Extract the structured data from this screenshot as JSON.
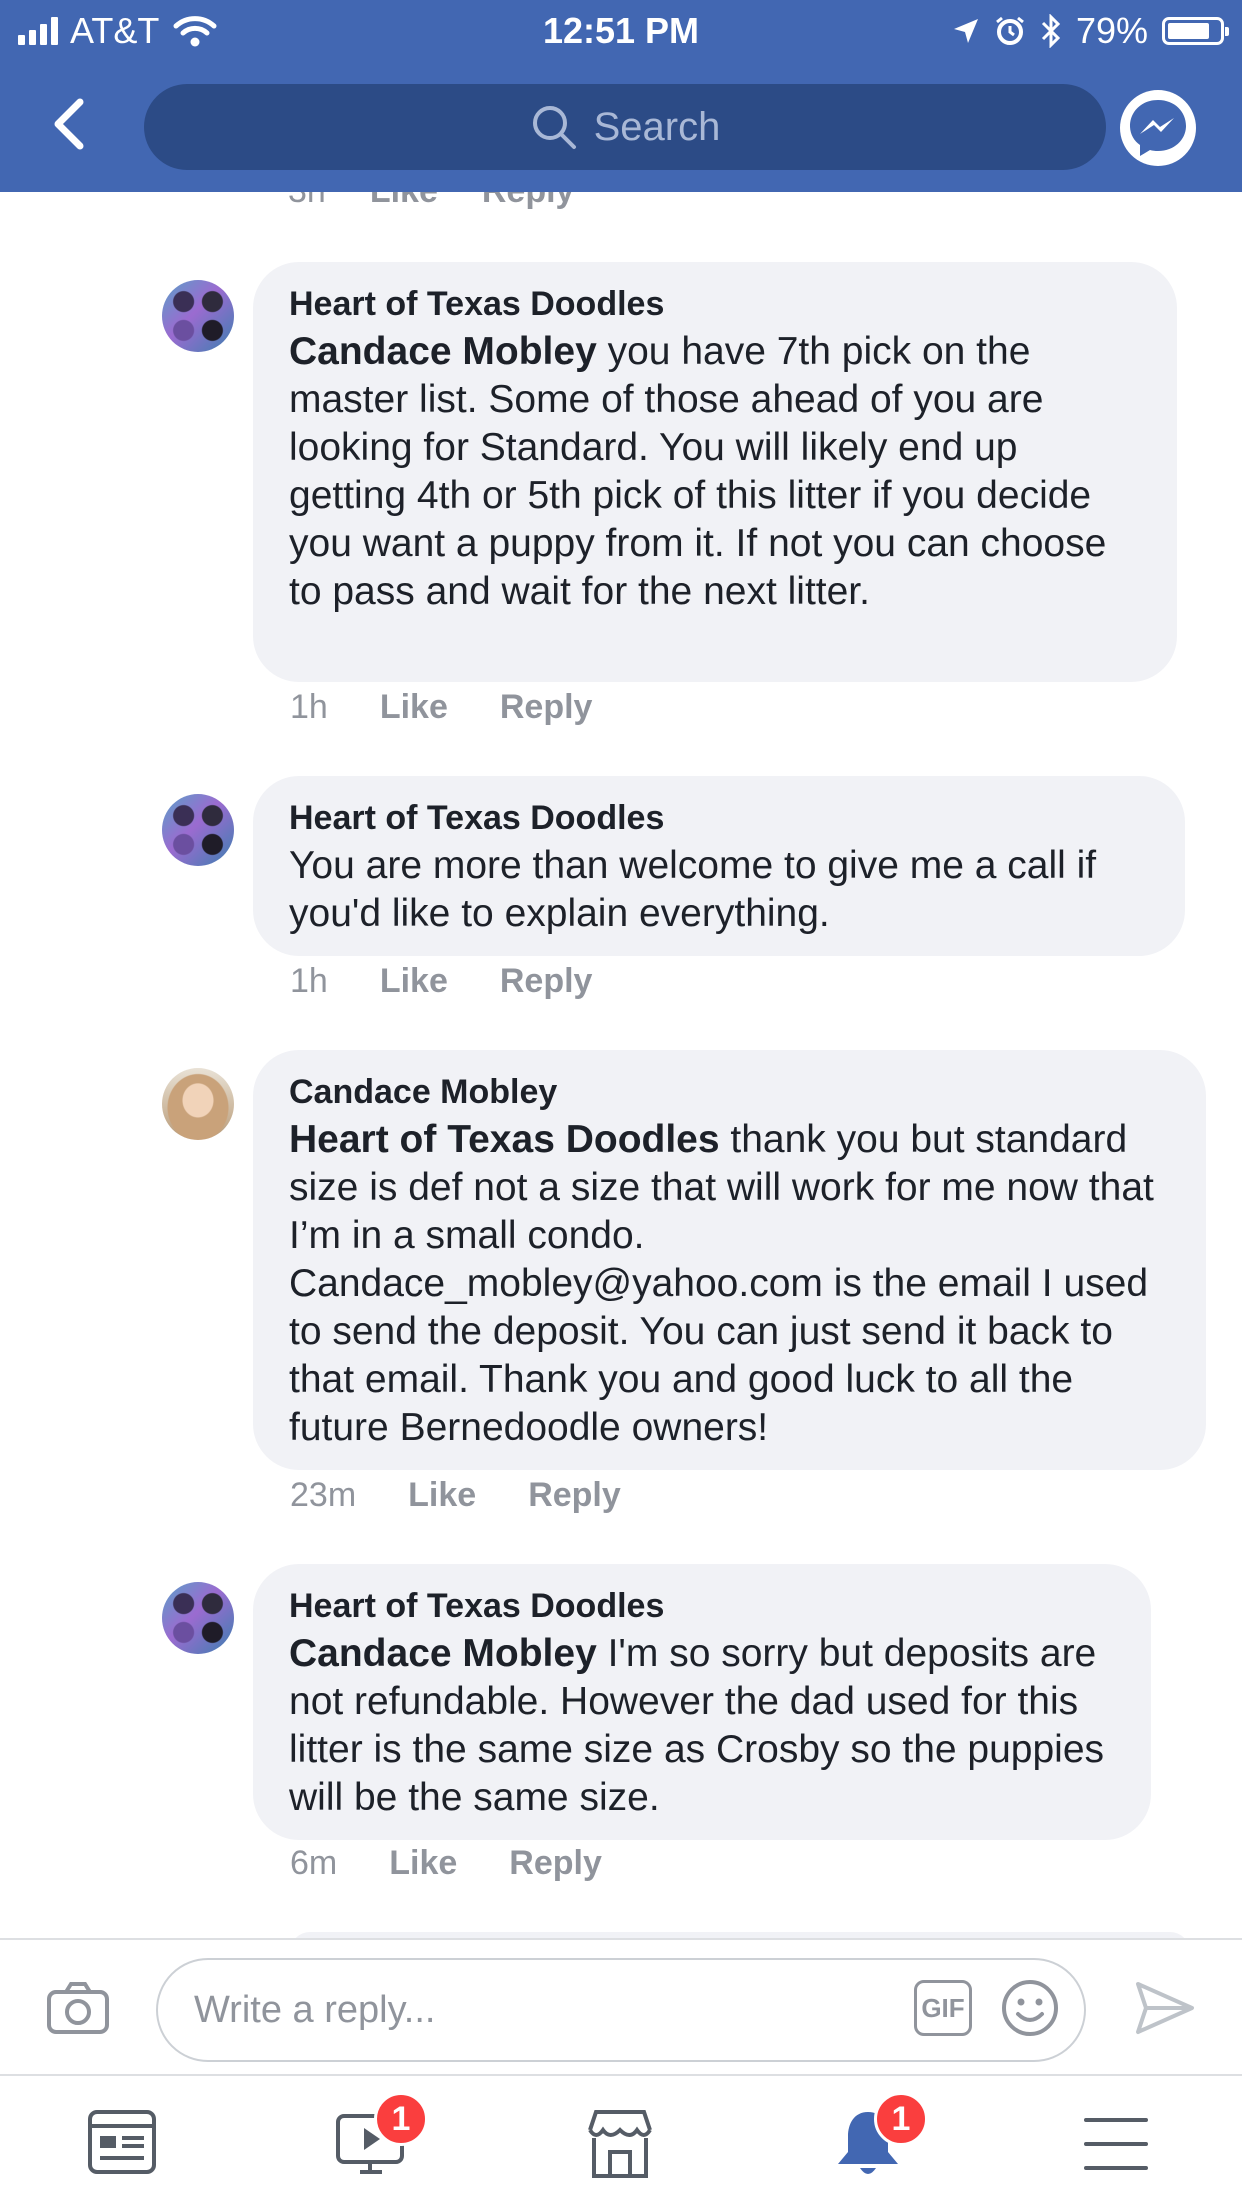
{
  "status_bar": {
    "carrier": "AT&T",
    "time": "12:51 PM",
    "battery": "79%"
  },
  "header": {
    "search_placeholder": "Search"
  },
  "previous_comment_actions": {
    "time": "3h",
    "like": "Like",
    "reply": "Reply"
  },
  "comments": [
    {
      "author": "Heart of Texas Doodles",
      "mention": "Candace Mobley",
      "text": " you have 7th pick on the master list.  Some of those ahead of you are looking for Standard.  You will likely end up getting 4th or 5th pick of this litter if you decide you want a puppy from it.  If not you can choose to pass and wait for the next litter.",
      "time": "1h",
      "like": "Like",
      "reply": "Reply"
    },
    {
      "author": "Heart of Texas Doodles",
      "mention": "",
      "text": "You are more than welcome to give me a call if you'd like to explain everything.",
      "time": "1h",
      "like": "Like",
      "reply": "Reply"
    },
    {
      "author": "Candace Mobley",
      "mention": "Heart of Texas Doodles",
      "text": " thank you but standard size is def not a size that will work for me now that I’m in a small condo. Candace_mobley@yahoo.com is the email I used to send the deposit. You can just send it back to that email. Thank you and good luck to all the future Bernedoodle owners!",
      "time": "23m",
      "like": "Like",
      "reply": "Reply"
    },
    {
      "author": "Heart of Texas Doodles",
      "mention": "Candace Mobley",
      "text": " I'm so sorry but deposits are not refundable.  However the dad used for this litter is the same size as Crosby so the puppies will be the same size.",
      "time": "6m",
      "like": "Like",
      "reply": "Reply"
    }
  ],
  "composer": {
    "placeholder": "Write a reply...",
    "gif_label": "GIF"
  },
  "tabbar": {
    "video_badge": "1",
    "notifications_badge": "1"
  },
  "colors": {
    "brand_blue": "#4267b2",
    "bubble_bg": "#f1f2f6",
    "meta_gray": "#90949c",
    "badge_red": "#fa3e3e"
  }
}
